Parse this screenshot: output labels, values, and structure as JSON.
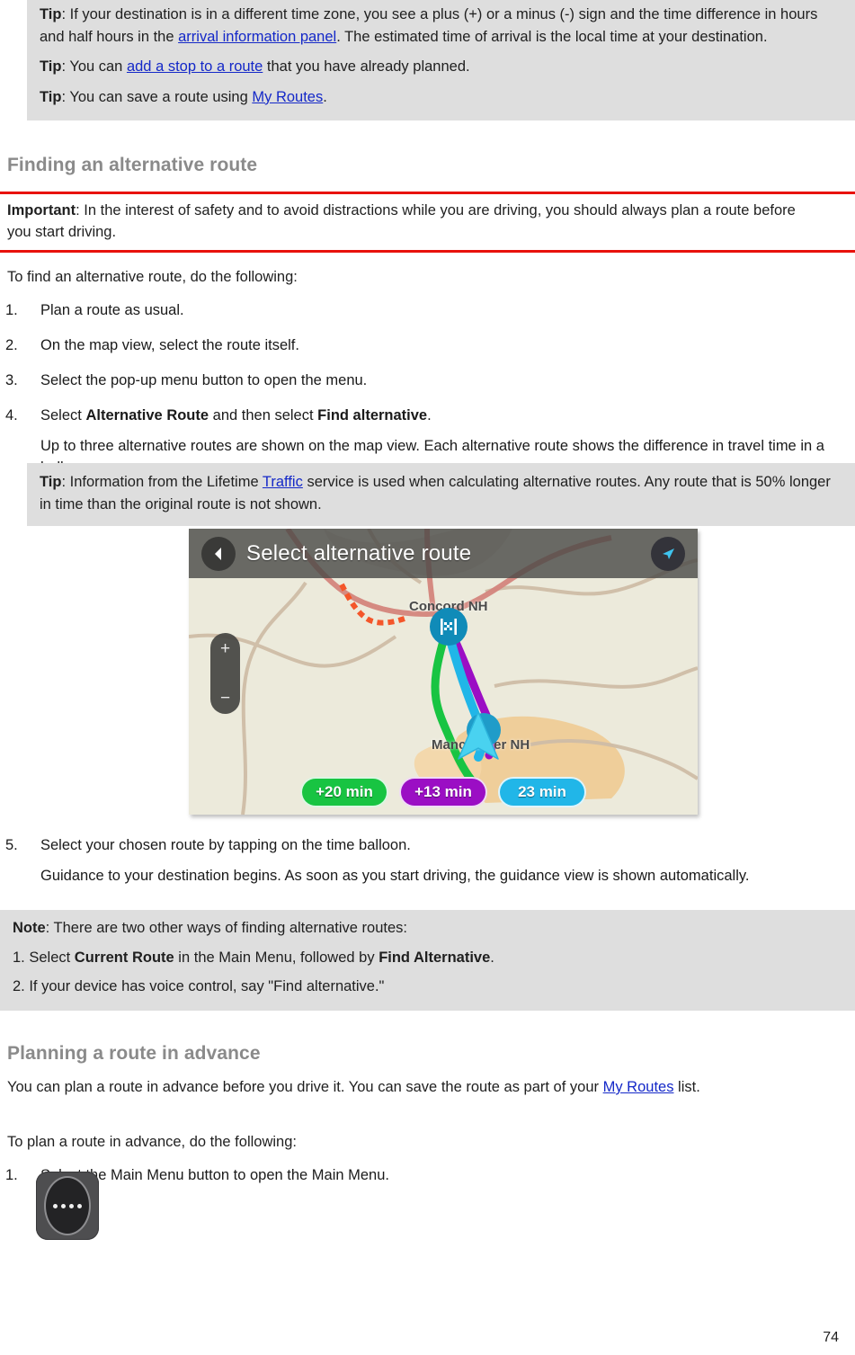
{
  "document": {
    "page_number": "74",
    "colors": {
      "callout_bg": "#dedede",
      "rule_red": "#e8120c",
      "heading_gray": "#8a8a8a",
      "link_blue": "#1428c8"
    }
  },
  "tips_top": {
    "tip1": {
      "label": "Tip",
      "text_before": ": If your destination is in a different time zone, you see a plus (+) or a minus (-) sign and the time difference in hours and half hours in the ",
      "link": "arrival information panel",
      "text_after": ". The estimated time of arrival is the local time at your destination."
    },
    "tip2": {
      "label": "Tip",
      "text_before": ": You can ",
      "link": "add a stop to a route",
      "text_after": " that you have already planned."
    },
    "tip3": {
      "label": "Tip",
      "text_before": ": You can save a route using ",
      "link": "My Routes",
      "text_after": "."
    }
  },
  "section_alternative": {
    "heading": "Finding an alternative route",
    "important": {
      "label": "Important",
      "text": ": In the interest of safety and to avoid distractions while you are driving, you should always plan a route before you start driving."
    },
    "intro": "To find an alternative route, do the following:",
    "steps": [
      {
        "num": "1.",
        "text": "Plan a route as usual."
      },
      {
        "num": "2.",
        "text": "On the map view, select the route itself."
      },
      {
        "num": "3.",
        "text": "Select the pop-up menu button to open the menu."
      },
      {
        "num": "4.",
        "text_before": "Select ",
        "bold1": "Alternative Route",
        "text_middle": " and then select ",
        "bold2": "Find alternative",
        "text_after": ".",
        "substep": "Up to three alternative routes are shown on the map view. Each alternative route shows the difference in travel time in a balloon."
      },
      {
        "num": "5.",
        "text": "Select your chosen route by tapping on the time balloon.",
        "substep": "Guidance to your destination begins. As soon as you start driving, the guidance view is shown automatically."
      }
    ],
    "tip_traffic": {
      "label": "Tip",
      "text_before": ": Information from the Lifetime ",
      "link": "Traffic",
      "text_after": " service is used when calculating alternative routes. Any route that is 50% longer in time than the original route is not shown."
    },
    "note": {
      "label": "Note",
      "intro": ": There are two other ways of finding alternative routes:",
      "item1": {
        "num": "1.",
        "text_before": " Select ",
        "bold": "Current Route",
        "text_middle": " in the Main Menu, followed by ",
        "bold2": "Find Alternative",
        "text_after": "."
      },
      "item2": {
        "num": "2.",
        "text": " If your device has voice control, say \"Find alternative.\""
      }
    }
  },
  "map_figure": {
    "title": "Select alternative route",
    "back_icon": "back-arrow-icon",
    "compass_icon": "navigation-arrow-icon",
    "zoom_in_label": "+",
    "zoom_out_label": "−",
    "destination_icon": "checkered-flag-icon",
    "city_labels": [
      {
        "name": "Concord NH"
      },
      {
        "name": "Manchester NH"
      }
    ],
    "balloons": [
      {
        "label": "+20 min",
        "color": "#18c442",
        "route": "green-alternative"
      },
      {
        "label": "+13 min",
        "color": "#9b0ec4",
        "route": "purple-alternative"
      },
      {
        "label": "23 min",
        "color": "#21b6e8",
        "route": "cyan-current"
      }
    ]
  },
  "section_planning": {
    "heading": "Planning a route in advance",
    "intro_before": "You can plan a route in advance before you drive it. You can save the route as part of your ",
    "intro_link": "My Routes",
    "intro_after": " list.",
    "lead": "To plan a route in advance, do the following:",
    "step1": {
      "num": "1.",
      "text": "Select the Main Menu button to open the Main Menu."
    },
    "menu_button_icon": "main-menu-button-icon"
  }
}
